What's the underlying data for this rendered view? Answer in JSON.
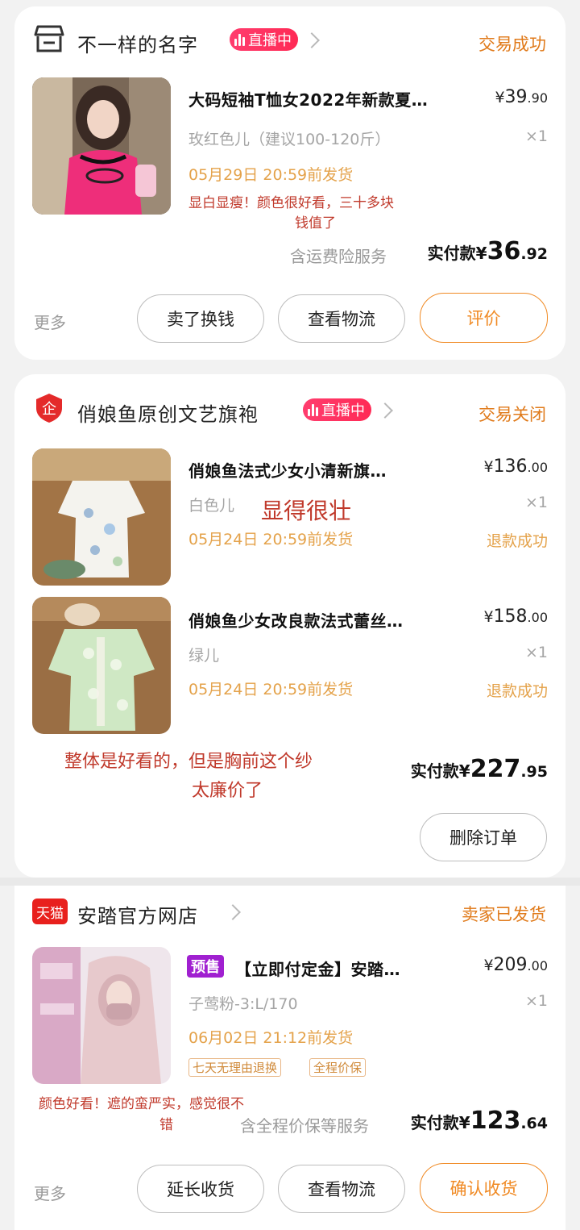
{
  "orders": [
    {
      "shop": "不一样的名字",
      "live": "直播中",
      "status": "交易成功",
      "items": [
        {
          "title": "大码短袖T恤女2022年新款夏…",
          "price_int": "39",
          "price_dec": ".90",
          "sku": "玫红色儿（建议100-120斤）",
          "qty": "×1",
          "ship": "05月29日  20:59前发货"
        }
      ],
      "note_line1": "显白显瘦！颜色很好看，三十多块",
      "note_line2": "钱值了",
      "service": "含运费险服务",
      "paid_label": "实付款¥",
      "paid_int": "36",
      "paid_dec": ".92",
      "more": "更多",
      "buttons": [
        "卖了换钱",
        "查看物流",
        "评价"
      ]
    },
    {
      "shop": "俏娘鱼原创文艺旗袍",
      "live": "直播中",
      "status": "交易关闭",
      "items": [
        {
          "title": "俏娘鱼法式少女小清新旗…",
          "price_int": "136",
          "price_dec": ".00",
          "sku": "白色儿",
          "qty": "×1",
          "ship": "05月24日  20:59前发货",
          "refund": "退款成功"
        },
        {
          "title": "俏娘鱼少女改良款法式蕾丝…",
          "price_int": "158",
          "price_dec": ".00",
          "sku": "绿儿",
          "qty": "×1",
          "ship": "05月24日  20:59前发货",
          "refund": "退款成功"
        }
      ],
      "handwritten_big": "显得很壮",
      "note_line1": "整体是好看的，但是胸前这个纱",
      "note_line2": "太廉价了",
      "paid_label": "实付款¥",
      "paid_int": "227",
      "paid_dec": ".95",
      "buttons": [
        "删除订单"
      ]
    },
    {
      "shop": "安踏官方网店",
      "tmall": "天猫",
      "status": "卖家已发货",
      "items": [
        {
          "presale": "预售",
          "title": "【立即付定金】安踏…",
          "price_int": "209",
          "price_dec": ".00",
          "sku": "子莺粉-3:L/170",
          "qty": "×1",
          "ship": "06月02日  21:12前发货",
          "tags": [
            "七天无理由退换",
            "全程价保"
          ]
        }
      ],
      "note_line1": "颜色好看！遮的蛮严实，感觉很不",
      "note_line2": "错",
      "service": "含全程价保等服务",
      "paid_label": "实付款¥",
      "paid_int": "123",
      "paid_dec": ".64",
      "more": "更多",
      "buttons": [
        "延长收货",
        "查看物流",
        "确认收货"
      ]
    }
  ],
  "colors": {
    "accent": "#f08a24",
    "live": "#ff2a55",
    "note": "#c0392b",
    "ship": "#e4a24a"
  },
  "icons": [
    "store-icon",
    "brand-shield-icon",
    "tmall-icon",
    "chevron-right-icon"
  ]
}
